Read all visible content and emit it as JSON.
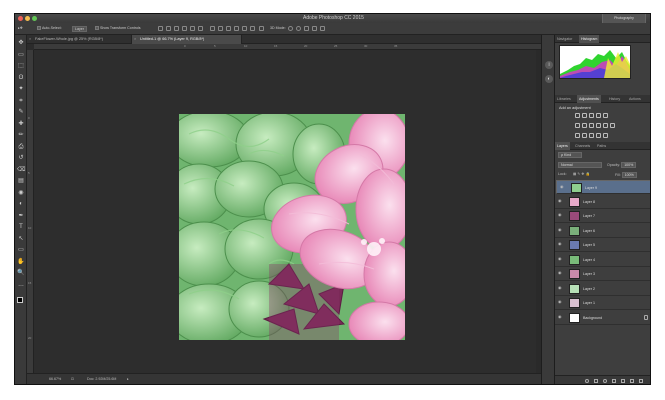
{
  "window": {
    "title": "Adobe Photoshop CC 2015",
    "workspace": "Photography"
  },
  "options_bar": {
    "auto_select_label": "Auto-Select:",
    "auto_select_value": "Layer",
    "show_transform_label": "Show Transform Controls",
    "mode_3d_label": "3D Mode:"
  },
  "tools": [
    "move-tool",
    "artboard-tool",
    "marquee-tool",
    "lasso-tool",
    "quick-select-tool",
    "crop-tool",
    "eyedropper-tool",
    "healing-brush-tool",
    "brush-tool",
    "clone-stamp-tool",
    "history-brush-tool",
    "eraser-tool",
    "gradient-tool",
    "blur-tool",
    "dodge-tool",
    "pen-tool",
    "type-tool",
    "path-select-tool",
    "rectangle-tool",
    "hand-tool",
    "zoom-tool",
    "more-tools"
  ],
  "tabs": [
    {
      "label": "FakeFlower-Whole.jpg @ 25% (RGB/8*)",
      "active": false
    },
    {
      "label": "Untitled-1 @ 66.7% (Layer 9, RGB/8*)",
      "active": true
    }
  ],
  "ruler_top": [
    "0",
    "5",
    "10",
    "15",
    "20",
    "25",
    "30",
    "35"
  ],
  "ruler_left": [
    "0",
    "5",
    "10",
    "15",
    "20"
  ],
  "status": {
    "zoom": "66.67%",
    "doc": "Doc: 2.92M/25.6M"
  },
  "panels": {
    "top_tabs": [
      "Navigator",
      "Histogram"
    ],
    "mid_tabs": [
      "Libraries",
      "Adjustments",
      "History",
      "Actions"
    ],
    "adjustments_title": "Add an adjustment",
    "layer_tabs": [
      "Layers",
      "Channels",
      "Paths"
    ],
    "kind_label": "Kind",
    "blend_mode": "Normal",
    "opacity_label": "Opacity:",
    "opacity_value": "100%",
    "lock_label": "Lock:",
    "fill_label": "Fill:",
    "fill_value": "100%"
  },
  "layers": [
    {
      "name": "Layer 9",
      "selected": true,
      "thumb": "#8fcf8f"
    },
    {
      "name": "Layer 8",
      "selected": false,
      "thumb": "#e7a9c9"
    },
    {
      "name": "Layer 7",
      "selected": false,
      "thumb": "#9a4a7a"
    },
    {
      "name": "Layer 6",
      "selected": false,
      "thumb": "#7ab07a"
    },
    {
      "name": "Layer 5",
      "selected": false,
      "thumb": "#6a7ab0"
    },
    {
      "name": "Layer 4",
      "selected": false,
      "thumb": "#79bb79"
    },
    {
      "name": "Layer 3",
      "selected": false,
      "thumb": "#c98aaa"
    },
    {
      "name": "Layer 2",
      "selected": false,
      "thumb": "#b7e0b7"
    },
    {
      "name": "Layer 1",
      "selected": false,
      "thumb": "#d8c0d0"
    },
    {
      "name": "Background",
      "selected": false,
      "thumb": "#ffffff"
    }
  ],
  "colors": {
    "accent_selected": "#5a6f8c",
    "panel": "#3e3e3e",
    "canvas": "#2d2d2d"
  }
}
